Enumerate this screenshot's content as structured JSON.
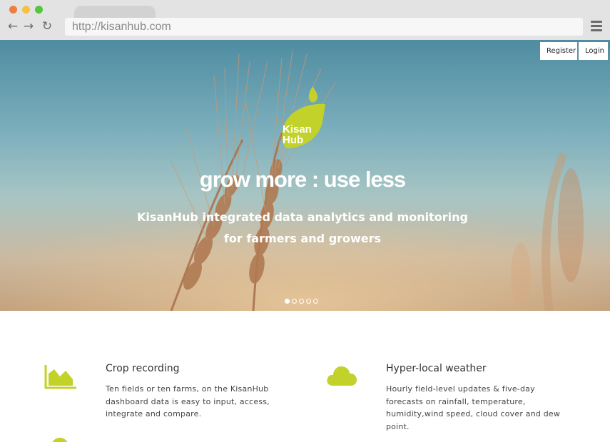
{
  "browser": {
    "url": "http://kisanhub.com",
    "back_icon": "back-arrow-icon",
    "forward_icon": "forward-arrow-icon",
    "reload_icon": "reload-icon",
    "menu_icon": "hamburger-menu-icon"
  },
  "header": {
    "register_label": "Register",
    "login_label": "Login"
  },
  "logo": {
    "line1": "Kisan",
    "line2": "Hub"
  },
  "hero": {
    "title": "grow more : use less",
    "subtitle": "KisanHub integrated data analytics and monitoring for farmers and growers",
    "slides": 5,
    "active_slide": 1
  },
  "features": [
    {
      "icon": "area-chart-icon",
      "title": "Crop recording",
      "text": "Ten fields or ten farms, on the KisanHub dashboard data is easy to input, access, integrate and compare."
    },
    {
      "icon": "cloud-icon",
      "title": "Hyper-local weather",
      "text": "Hourly field-level updates & five-day forecasts on rainfall, temperature, humidity,wind speed, cloud cover and dew point."
    }
  ],
  "colors": {
    "accent": "#c2d22a",
    "chrome": "#e3e3e3"
  }
}
